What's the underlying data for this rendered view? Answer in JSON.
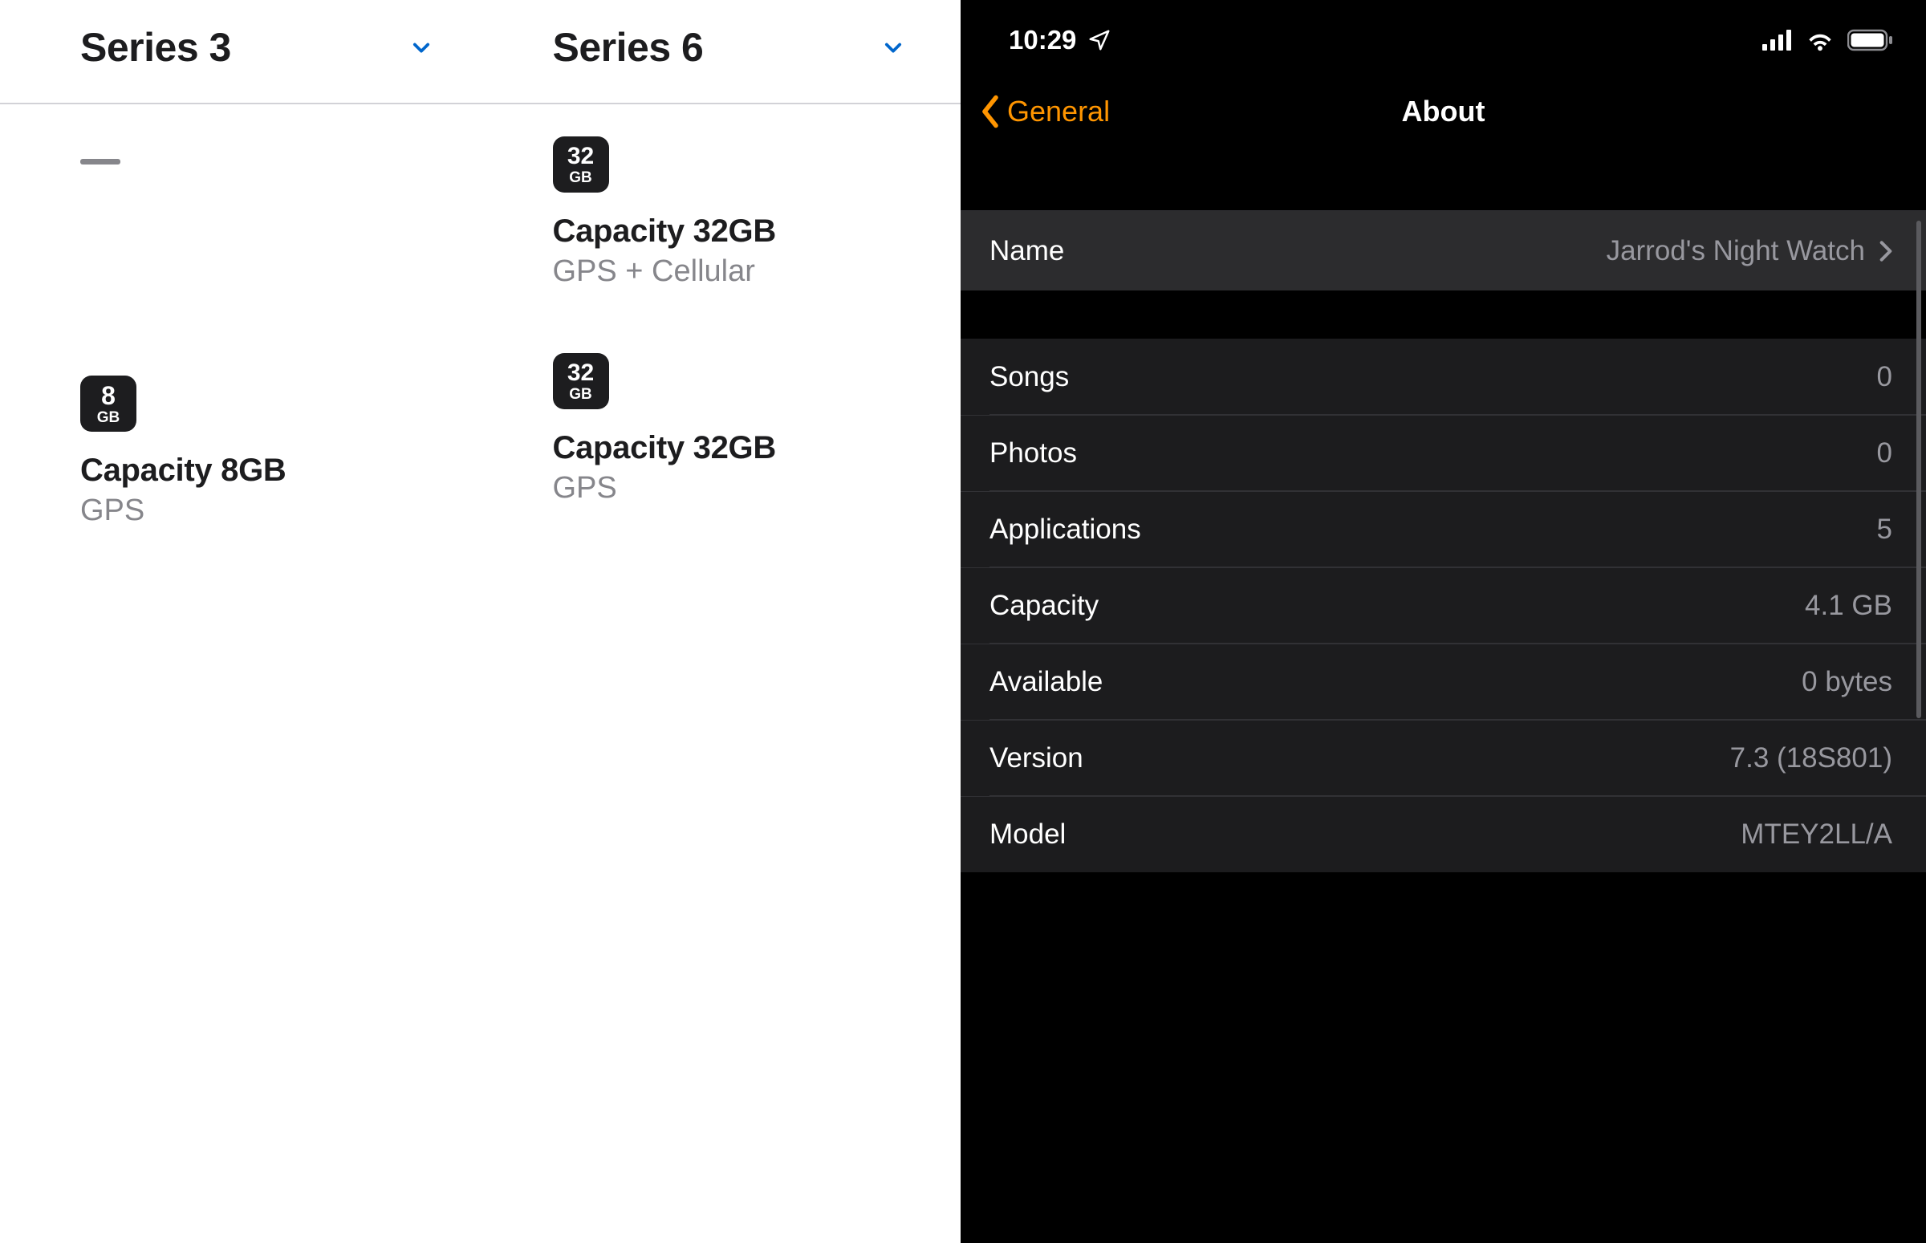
{
  "left": {
    "columns": [
      {
        "name": "Series 3",
        "specs": [
          {
            "type": "placeholder"
          },
          {
            "type": "capacity",
            "num": "8",
            "unit": "GB",
            "title": "Capacity 8GB",
            "sub": "GPS"
          }
        ]
      },
      {
        "name": "Series 6",
        "specs": [
          {
            "type": "capacity",
            "num": "32",
            "unit": "GB",
            "title": "Capacity 32GB",
            "sub": "GPS + Cellular"
          },
          {
            "type": "capacity",
            "num": "32",
            "unit": "GB",
            "title": "Capacity 32GB",
            "sub": "GPS"
          }
        ]
      }
    ]
  },
  "right": {
    "status": {
      "time": "10:29"
    },
    "nav": {
      "back": "General",
      "title": "About"
    },
    "name_row": {
      "label": "Name",
      "value": "Jarrod's Night Watch"
    },
    "rows": [
      {
        "label": "Songs",
        "value": "0"
      },
      {
        "label": "Photos",
        "value": "0"
      },
      {
        "label": "Applications",
        "value": "5"
      },
      {
        "label": "Capacity",
        "value": "4.1 GB"
      },
      {
        "label": "Available",
        "value": "0 bytes"
      },
      {
        "label": "Version",
        "value": "7.3 (18S801)"
      },
      {
        "label": "Model",
        "value": "MTEY2LL/A"
      }
    ]
  }
}
